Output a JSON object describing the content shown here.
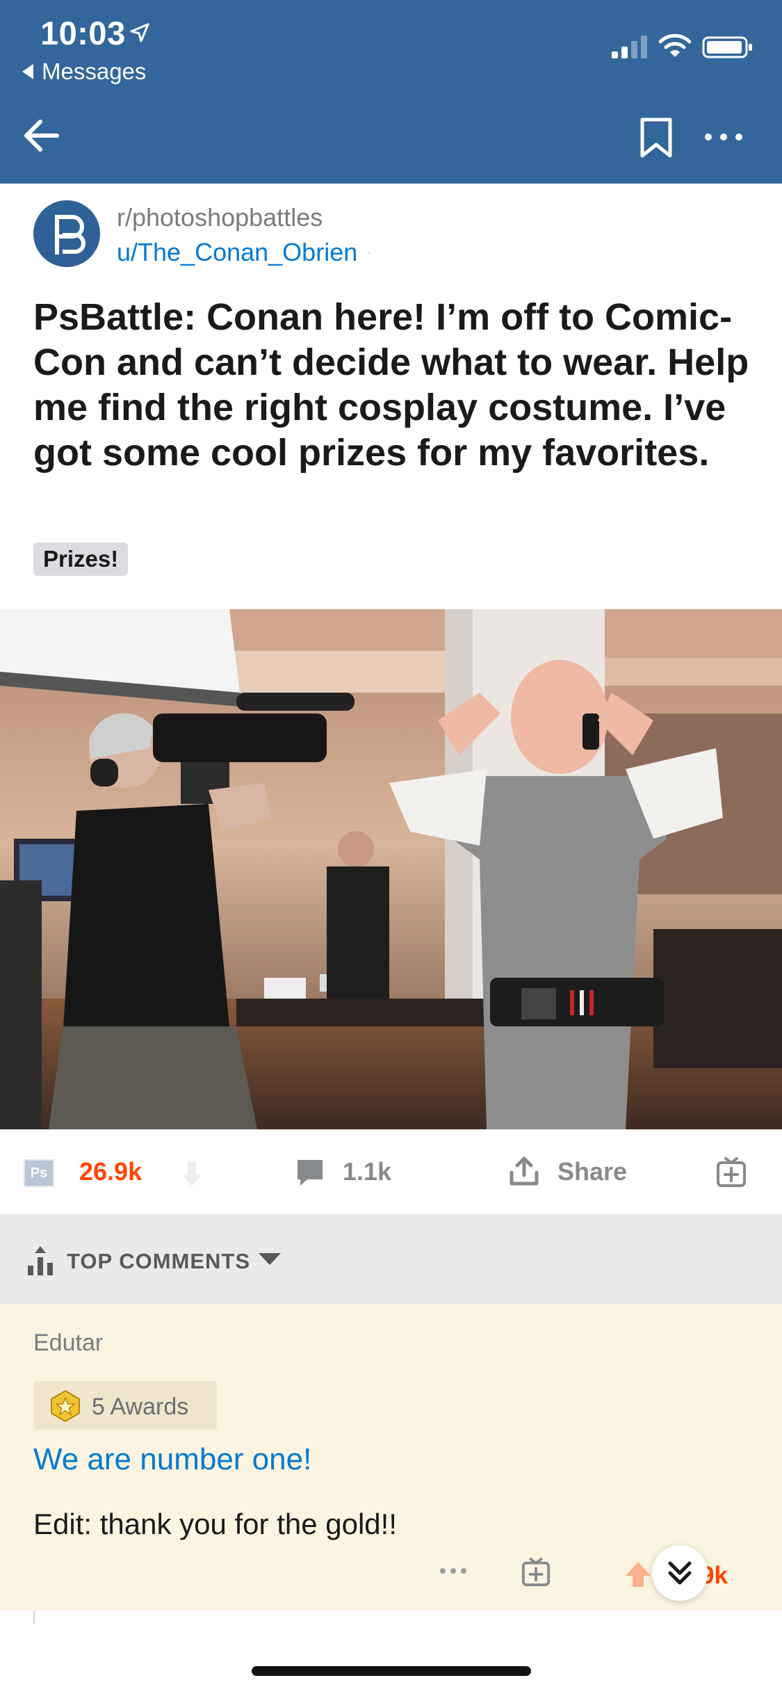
{
  "status_bar": {
    "time": "10:03",
    "back_app": "Messages"
  },
  "nav": {
    "back_icon": "arrow-left-icon",
    "bookmark_icon": "bookmark-icon",
    "more_icon": "more-horizontal-icon"
  },
  "post": {
    "subreddit": "r/photoshopbattles",
    "author": "u/The_Conan_Obrien",
    "author_separator": "·",
    "title": "PsBattle: Conan here! I’m off to Comic-Con and can’t decide what to wear. Help me find the right cosplay costume. I’ve got some cool prizes for my favorites.",
    "flair": "Prizes!",
    "sub_icon_text": "Ps",
    "score": "26.9k",
    "comments": "1.1k",
    "share": "Share"
  },
  "comments_header": {
    "sort_label": "TOP COMMENTS"
  },
  "comment": {
    "author": "Edutar",
    "awards": "5 Awards",
    "link_text": "We are number one!",
    "body": "Edit: thank you for the gold!!",
    "score": "9k"
  },
  "colors": {
    "header": "#33669b",
    "accent_orange": "#ff4500",
    "link_blue": "#0079d3",
    "comment_bg": "#fbf4e0",
    "sortbar_bg": "#e9eaec"
  }
}
